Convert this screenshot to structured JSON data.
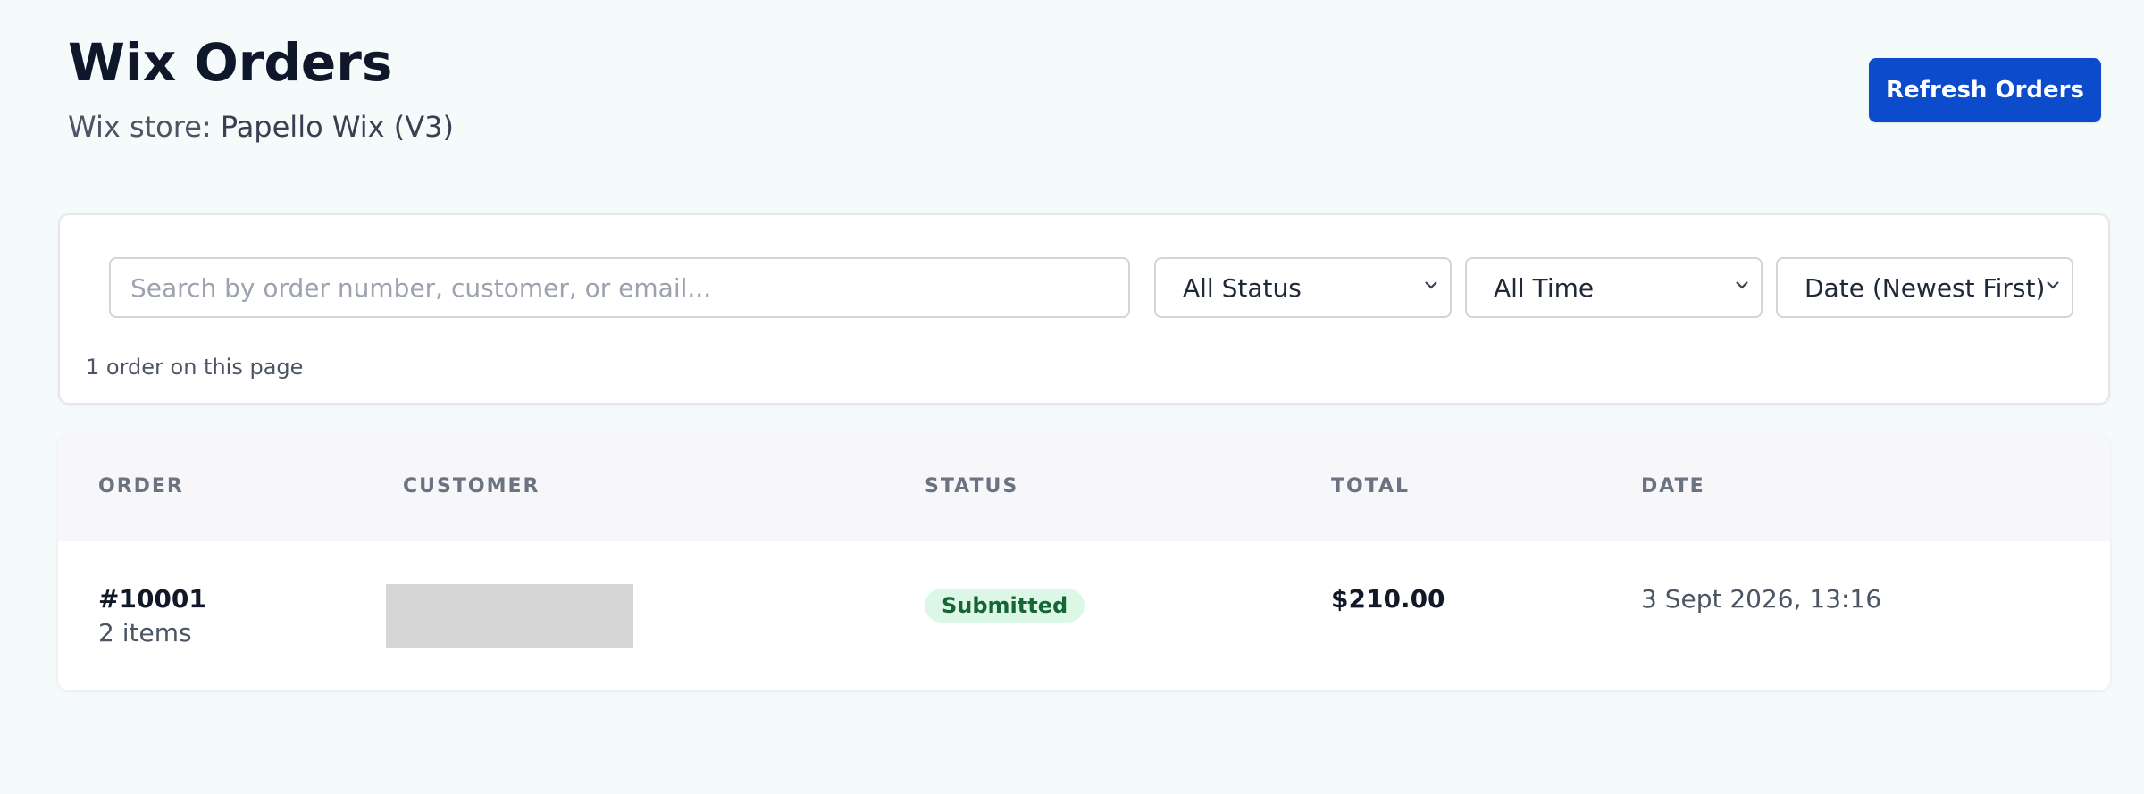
{
  "header": {
    "title": "Wix Orders",
    "subtitle_prefix": "Wix store: ",
    "store_name": "Papello Wix (V3)",
    "refresh_label": "Refresh Orders"
  },
  "filters": {
    "search_placeholder": "Search by order number, customer, or email...",
    "search_value": "",
    "status_selected": "All Status",
    "time_selected": "All Time",
    "sort_selected": "Date (Newest First)",
    "count_text": "1 order on this page"
  },
  "table": {
    "columns": [
      "ORDER",
      "CUSTOMER",
      "STATUS",
      "TOTAL",
      "DATE"
    ],
    "rows": [
      {
        "order_number": "#10001",
        "items": "2 items",
        "status": "Submitted",
        "total": "$210.00",
        "date": "3 Sept 2026, 13:16"
      }
    ]
  },
  "colors": {
    "accent": "#0b4bcc",
    "status_submitted_bg": "#dcf7e6",
    "status_submitted_text": "#166534",
    "background": "#f5fafb"
  },
  "icons": {
    "select_chevron": "chevron-down-icon"
  }
}
